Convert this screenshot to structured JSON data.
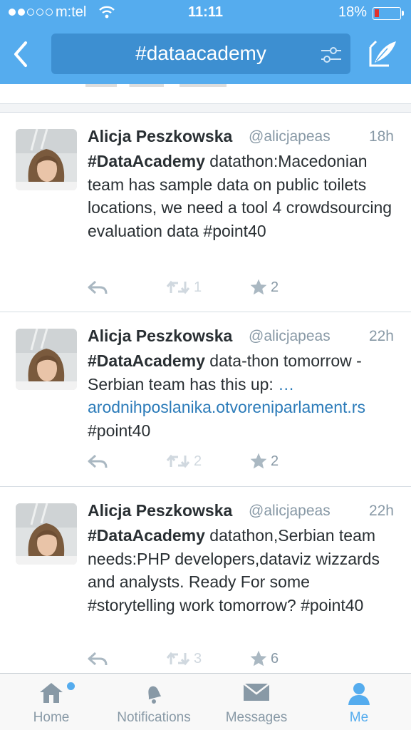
{
  "status_bar": {
    "carrier": "m:tel",
    "time": "11:11",
    "battery": "18%",
    "battery_level": 0.18
  },
  "header": {
    "search_query": "#dataacademy",
    "back_icon": "chevron-left-icon",
    "filter_icon": "sliders-icon",
    "compose_icon": "quill-icon"
  },
  "tweets": [
    {
      "name": "Alicja Peszkowska",
      "handle": "@alicjapeas",
      "time": "18h",
      "lead": "#DataAcademy",
      "text": " datathon:Macedonian team has sample data on public toilets locations, we need a tool 4 crowdsourcing evaluation data #point40",
      "link": "",
      "tail": "",
      "retweets": "1",
      "favorites": "2"
    },
    {
      "name": "Alicja Peszkowska",
      "handle": "@alicjapeas",
      "time": "22h",
      "lead": "#DataAcademy",
      "text": " data-thon tomorrow - Serbian team has this up: ",
      "link": "… arodnihposlanika.otvoreniparlament.rs",
      "tail": " #point40",
      "retweets": "2",
      "favorites": "2"
    },
    {
      "name": "Alicja Peszkowska",
      "handle": "@alicjapeas",
      "time": "22h",
      "lead": "#DataAcademy",
      "text": " datathon,Serbian team needs:PHP developers,dataviz wizzards and analysts. Ready For some #storytelling work tomorrow? #point40",
      "link": "",
      "tail": "",
      "retweets": "3",
      "favorites": "6"
    }
  ],
  "tabs": {
    "home": "Home",
    "notifications": "Notifications",
    "messages": "Messages",
    "me": "Me"
  },
  "colors": {
    "brand": "#55acee",
    "link": "#2b7bb9",
    "muted": "#8899a6"
  }
}
